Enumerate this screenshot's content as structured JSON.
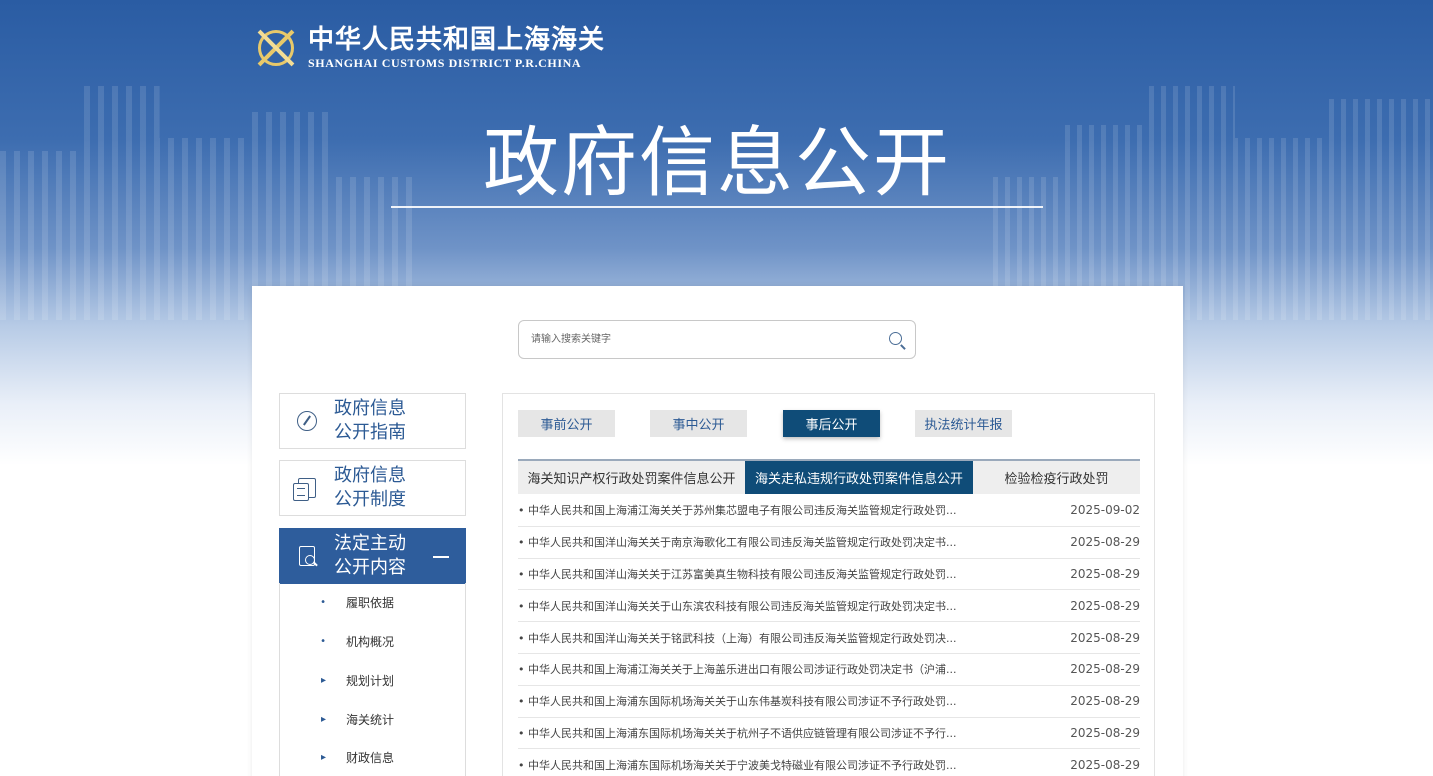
{
  "header": {
    "logo_cn": "中华人民共和国上海海关",
    "logo_en": "SHANGHAI CUSTOMS DISTRICT P.R.CHINA",
    "hero_title": "政府信息公开"
  },
  "search": {
    "placeholder": "请输入搜索关键字"
  },
  "sidebar": {
    "items": [
      {
        "line1": "政府信息",
        "line2": "公开指南"
      },
      {
        "line1": "政府信息",
        "line2": "公开制度"
      },
      {
        "line1": "法定主动",
        "line2": "公开内容"
      }
    ],
    "sub_items": [
      {
        "bullet": "•",
        "label": "履职依据"
      },
      {
        "bullet": "•",
        "label": "机构概况"
      },
      {
        "bullet": "▸",
        "label": "规划计划"
      },
      {
        "bullet": "▸",
        "label": "海关统计"
      },
      {
        "bullet": "▸",
        "label": "财政信息"
      }
    ]
  },
  "tabs_primary": [
    "事前公开",
    "事中公开",
    "事后公开",
    "执法统计年报"
  ],
  "tabs_secondary": [
    "海关知识产权行政处罚案件信息公开",
    "海关走私违规行政处罚案件信息公开",
    "检验检疫行政处罚"
  ],
  "list": [
    {
      "title": "• 中华人民共和国上海浦江海关关于苏州集芯盟电子有限公司违反海关监管规定行政处罚...",
      "date": "2025-09-02"
    },
    {
      "title": "• 中华人民共和国洋山海关关于南京海歌化工有限公司违反海关监管规定行政处罚决定书...",
      "date": "2025-08-29"
    },
    {
      "title": "• 中华人民共和国洋山海关关于江苏富美真生物科技有限公司违反海关监管规定行政处罚...",
      "date": "2025-08-29"
    },
    {
      "title": "• 中华人民共和国洋山海关关于山东滨农科技有限公司违反海关监管规定行政处罚决定书...",
      "date": "2025-08-29"
    },
    {
      "title": "• 中华人民共和国洋山海关关于铭武科技（上海）有限公司违反海关监管规定行政处罚决...",
      "date": "2025-08-29"
    },
    {
      "title": "• 中华人民共和国上海浦江海关关于上海盖乐进出口有限公司涉证行政处罚决定书（沪浦...",
      "date": "2025-08-29"
    },
    {
      "title": "• 中华人民共和国上海浦东国际机场海关关于山东伟基炭科技有限公司涉证不予行政处罚...",
      "date": "2025-08-29"
    },
    {
      "title": "• 中华人民共和国上海浦东国际机场海关关于杭州子不语供应链管理有限公司涉证不予行...",
      "date": "2025-08-29"
    },
    {
      "title": "• 中华人民共和国上海浦东国际机场海关关于宁波美戈特磁业有限公司涉证不予行政处罚...",
      "date": "2025-08-29"
    }
  ]
}
